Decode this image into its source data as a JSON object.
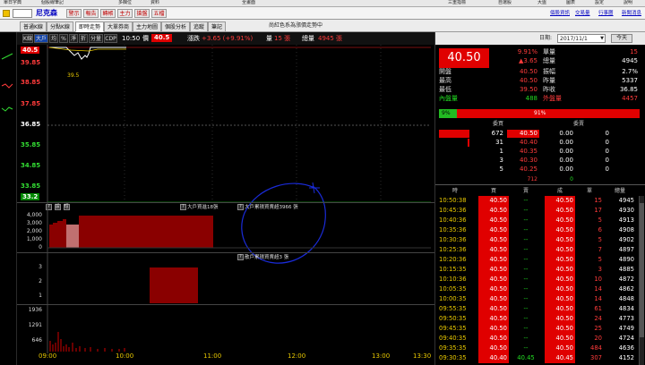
{
  "toolbar": {
    "items": [
      "單日字典",
      "個股線筆記",
      "多欄位",
      "資料",
      "全畫面",
      "三重指標",
      "自選股",
      "大盤",
      "圖表",
      "設定",
      "說明"
    ]
  },
  "quote": {
    "name": "尼克森",
    "buttons": [
      "警示",
      "報告",
      "轉帳",
      "主力",
      "搶盤",
      "五檔"
    ],
    "links": [
      "個股資訊",
      "交易量",
      "行事曆",
      "新聞消息"
    ]
  },
  "tabs": [
    "普通K線",
    "分點K線",
    "即時走勢",
    "大單券商",
    "主力地圖",
    "個股分析",
    "追蹤",
    "筆記"
  ],
  "active_tab": "即時走勢",
  "chart_title": "尚紅色系為漲價走勢中",
  "chart_header": {
    "buttons": [
      "K線",
      "大戶",
      "均",
      "%",
      "淨",
      "折",
      "分量",
      "CDP"
    ],
    "time": "10:50",
    "price_label": "價",
    "price": "40.5",
    "change_label": "漲跌",
    "change": "+3.65 (+9.91%)",
    "volume_label": "量",
    "volume": "15 張",
    "total_label": "總量",
    "total": "4945 張"
  },
  "price_axis": [
    {
      "label": "40.5",
      "cls": "hl"
    },
    {
      "label": "39.85",
      "cls": "red"
    },
    {
      "label": "38.85",
      "cls": "red"
    },
    {
      "label": "37.85",
      "cls": "red"
    },
    {
      "label": "36.85",
      "cls": "wht"
    },
    {
      "label": "35.85",
      "cls": "green"
    },
    {
      "label": "34.85",
      "cls": "green"
    },
    {
      "label": "33.85",
      "cls": "green"
    },
    {
      "label": "33.2",
      "cls": "hlg"
    }
  ],
  "low_label": "39.5",
  "pane2": {
    "buttons": [
      "?",
      "設",
      "短"
    ],
    "axis": [
      "4,000",
      "3,000",
      "2,000",
      "1,000",
      "0"
    ],
    "annot_left": "大戶買進18張",
    "annot_right": "大戶累積買賣超3966 張"
  },
  "pane3": {
    "axis": [
      "3",
      "2",
      "1"
    ],
    "annot": "散戶累積買賣超3 張"
  },
  "pane4": {
    "axis": [
      "1936",
      "1291",
      "646"
    ]
  },
  "time_axis": [
    "09:00",
    "10:00",
    "11:00",
    "12:00",
    "13:00",
    "13:30"
  ],
  "right": {
    "date_label": "日期:",
    "date": "2017/11/1",
    "today": "今天",
    "big_price": "40.50",
    "pct": "9.91%",
    "chg": "▲3.65",
    "label_dan": "單量",
    "dan_val": "15",
    "label_total": "總量",
    "total_val": "4945",
    "rows": [
      {
        "l1": "開盤",
        "v1": "40.50",
        "l2": "振幅",
        "v2": "2.7%"
      },
      {
        "l1": "最高",
        "v1": "40.50",
        "l2": "昨量",
        "v2": "5337"
      },
      {
        "l1": "最低",
        "v1": "39.50",
        "l2": "昨收",
        "v2": "36.85"
      },
      {
        "l1": "內盤量",
        "v1": "488",
        "l2": "外盤量",
        "v2": "4457"
      }
    ],
    "ratio_left": "9%",
    "ratio_right": "91%",
    "ratio_value": 0.09,
    "book_header": [
      "委買",
      "委賣"
    ],
    "book": [
      {
        "bq": "672",
        "bp": "40.50",
        "sp": "0.00",
        "sq": "0"
      },
      {
        "bq": "31",
        "bp": "40.40",
        "sp": "0.00",
        "sq": "0"
      },
      {
        "bq": "1",
        "bp": "40.35",
        "sp": "0.00",
        "sq": "0"
      },
      {
        "bq": "3",
        "bp": "40.30",
        "sp": "0.00",
        "sq": "0"
      },
      {
        "bq": "5",
        "bp": "40.25",
        "sp": "0.00",
        "sq": "0"
      }
    ],
    "book_total_buy": "712",
    "book_total_sell": "0",
    "tick_header": [
      "時",
      "買",
      "賣",
      "成",
      "單",
      "總量"
    ],
    "ticks": [
      {
        "t": "10:50:38",
        "b": "40.50",
        "s": "--",
        "p": "40.50",
        "q": "15",
        "v": "4945"
      },
      {
        "t": "10:45:36",
        "b": "40.50",
        "s": "--",
        "p": "40.50",
        "q": "17",
        "v": "4930"
      },
      {
        "t": "10:40:36",
        "b": "40.50",
        "s": "--",
        "p": "40.50",
        "q": "5",
        "v": "4913"
      },
      {
        "t": "10:35:36",
        "b": "40.50",
        "s": "--",
        "p": "40.50",
        "q": "6",
        "v": "4908"
      },
      {
        "t": "10:30:36",
        "b": "40.50",
        "s": "--",
        "p": "40.50",
        "q": "5",
        "v": "4902"
      },
      {
        "t": "10:25:36",
        "b": "40.50",
        "s": "--",
        "p": "40.50",
        "q": "7",
        "v": "4897"
      },
      {
        "t": "10:20:36",
        "b": "40.50",
        "s": "--",
        "p": "40.50",
        "q": "5",
        "v": "4890"
      },
      {
        "t": "10:15:35",
        "b": "40.50",
        "s": "--",
        "p": "40.50",
        "q": "3",
        "v": "4885"
      },
      {
        "t": "10:10:36",
        "b": "40.50",
        "s": "--",
        "p": "40.50",
        "q": "10",
        "v": "4872"
      },
      {
        "t": "10:05:35",
        "b": "40.50",
        "s": "--",
        "p": "40.50",
        "q": "14",
        "v": "4862"
      },
      {
        "t": "10:00:35",
        "b": "40.50",
        "s": "--",
        "p": "40.50",
        "q": "14",
        "v": "4848"
      },
      {
        "t": "09:55:35",
        "b": "40.50",
        "s": "--",
        "p": "40.50",
        "q": "61",
        "v": "4834"
      },
      {
        "t": "09:50:35",
        "b": "40.50",
        "s": "--",
        "p": "40.50",
        "q": "24",
        "v": "4773"
      },
      {
        "t": "09:45:35",
        "b": "40.50",
        "s": "--",
        "p": "40.50",
        "q": "25",
        "v": "4749"
      },
      {
        "t": "09:40:35",
        "b": "40.50",
        "s": "--",
        "p": "40.50",
        "q": "20",
        "v": "4724"
      },
      {
        "t": "09:35:35",
        "b": "40.50",
        "s": "--",
        "p": "40.50",
        "q": "484",
        "v": "4636"
      },
      {
        "t": "09:30:35",
        "b": "40.40",
        "s": "40.45",
        "p": "40.45",
        "q": "307",
        "v": "4152"
      }
    ]
  },
  "colors": {
    "up": "#ff3b3b",
    "down": "#22dd22",
    "bar": "#8a0000",
    "accent": "#e8c800"
  }
}
